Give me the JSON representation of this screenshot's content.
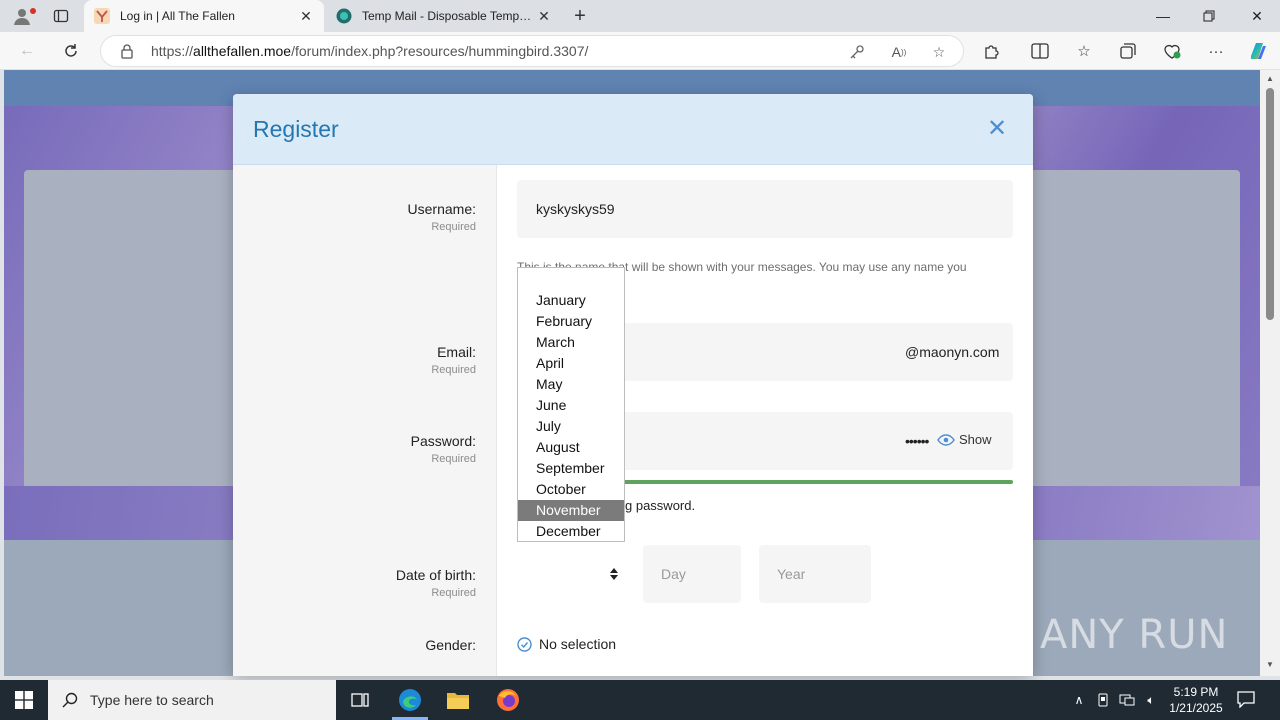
{
  "browser": {
    "tabs": [
      {
        "title": "Log in | All The Fallen",
        "active": true
      },
      {
        "title": "Temp Mail - Disposable Temporary Email",
        "active": false
      }
    ],
    "url_prefix": "https://",
    "url_domain": "allthefallen.moe",
    "url_path": "/forum/index.php?resources/hummingbird.3307/"
  },
  "modal": {
    "title": "Register",
    "fields": {
      "username": {
        "label": "Username:",
        "hint": "Required",
        "value": "kyskyskys59"
      },
      "username_explain": "This is the name that will be shown with your messages. You may use any name you",
      "email": {
        "label": "Email:",
        "hint": "Required",
        "value_visible": "@maonyn.com"
      },
      "password": {
        "label": "Password:",
        "hint": "Required",
        "value_visible": "••••••",
        "show_label": "Show"
      },
      "password_strength_text": "g password.",
      "dob": {
        "label": "Date of birth:",
        "hint": "Required",
        "day_placeholder": "Day",
        "year_placeholder": "Year"
      },
      "gender": {
        "label": "Gender:",
        "value": "No selection"
      }
    }
  },
  "month_dropdown": {
    "options": [
      "January",
      "February",
      "March",
      "April",
      "May",
      "June",
      "July",
      "August",
      "September",
      "October",
      "November",
      "December"
    ],
    "highlighted": "November"
  },
  "watermark": "ANY RUN",
  "taskbar": {
    "search_placeholder": "Type here to search",
    "time": "5:19 PM",
    "date": "1/21/2025"
  },
  "colors": {
    "modal_title": "#2577b1",
    "modal_header_bg": "#dbeaf7",
    "strength_bar": "#5ea45e",
    "dropdown_selected": "#7b7b7b"
  }
}
